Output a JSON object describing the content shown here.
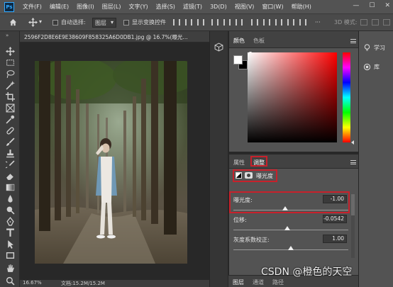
{
  "app": {
    "logo": "Ps"
  },
  "menu": [
    "文件(F)",
    "编辑(E)",
    "图像(I)",
    "图层(L)",
    "文字(Y)",
    "选择(S)",
    "滤镜(T)",
    "3D(D)",
    "视图(V)",
    "窗口(W)",
    "帮助(H)"
  ],
  "window_controls": {
    "minimize": "—",
    "maximize": "☐",
    "close": "✕"
  },
  "options_bar": {
    "auto_select_label": "自动选择:",
    "auto_select_value": "图层",
    "show_transform_label": "显示变换控件",
    "mode_label": "3D 模式:"
  },
  "document": {
    "tab_title": "2596F2D8E6E9E38609F858325A6D0DB1.jpg @ 16.7%(曝光...",
    "zoom": "16.67%",
    "doc_info": "文档:15.2M/15.2M"
  },
  "color_panel": {
    "tabs": [
      "颜色",
      "色板"
    ],
    "active_tab": "颜色"
  },
  "properties_panel": {
    "tabs": [
      "属性",
      "调整"
    ],
    "active_tab": "调整",
    "adjustment_name": "曝光度",
    "sliders": [
      {
        "label": "曝光度:",
        "value": "-1.00",
        "position": 0.45
      },
      {
        "label": "位移:",
        "value": "-0.0542",
        "position": 0.47
      },
      {
        "label": "灰度系数校正:",
        "value": "1.00",
        "position": 0.5
      }
    ]
  },
  "layers_tabs": [
    "图层",
    "通道",
    "路径"
  ],
  "right_panel": {
    "items": [
      "学习",
      "库"
    ]
  },
  "watermark": "CSDN @橙色的天空",
  "colors": {
    "accent": "#31a8ff",
    "highlight_box": "#c7212b"
  },
  "icons": {
    "tools": [
      "move-tool-icon",
      "marquee-tool-icon",
      "lasso-tool-icon",
      "magic-wand-tool-icon",
      "crop-tool-icon",
      "frame-tool-icon",
      "eyedropper-tool-icon",
      "healing-brush-tool-icon",
      "brush-tool-icon",
      "clone-stamp-tool-icon",
      "history-brush-tool-icon",
      "eraser-tool-icon",
      "gradient-tool-icon",
      "blur-tool-icon",
      "dodge-tool-icon",
      "pen-tool-icon",
      "type-tool-icon",
      "path-selection-tool-icon",
      "rectangle-tool-icon",
      "hand-tool-icon"
    ]
  }
}
